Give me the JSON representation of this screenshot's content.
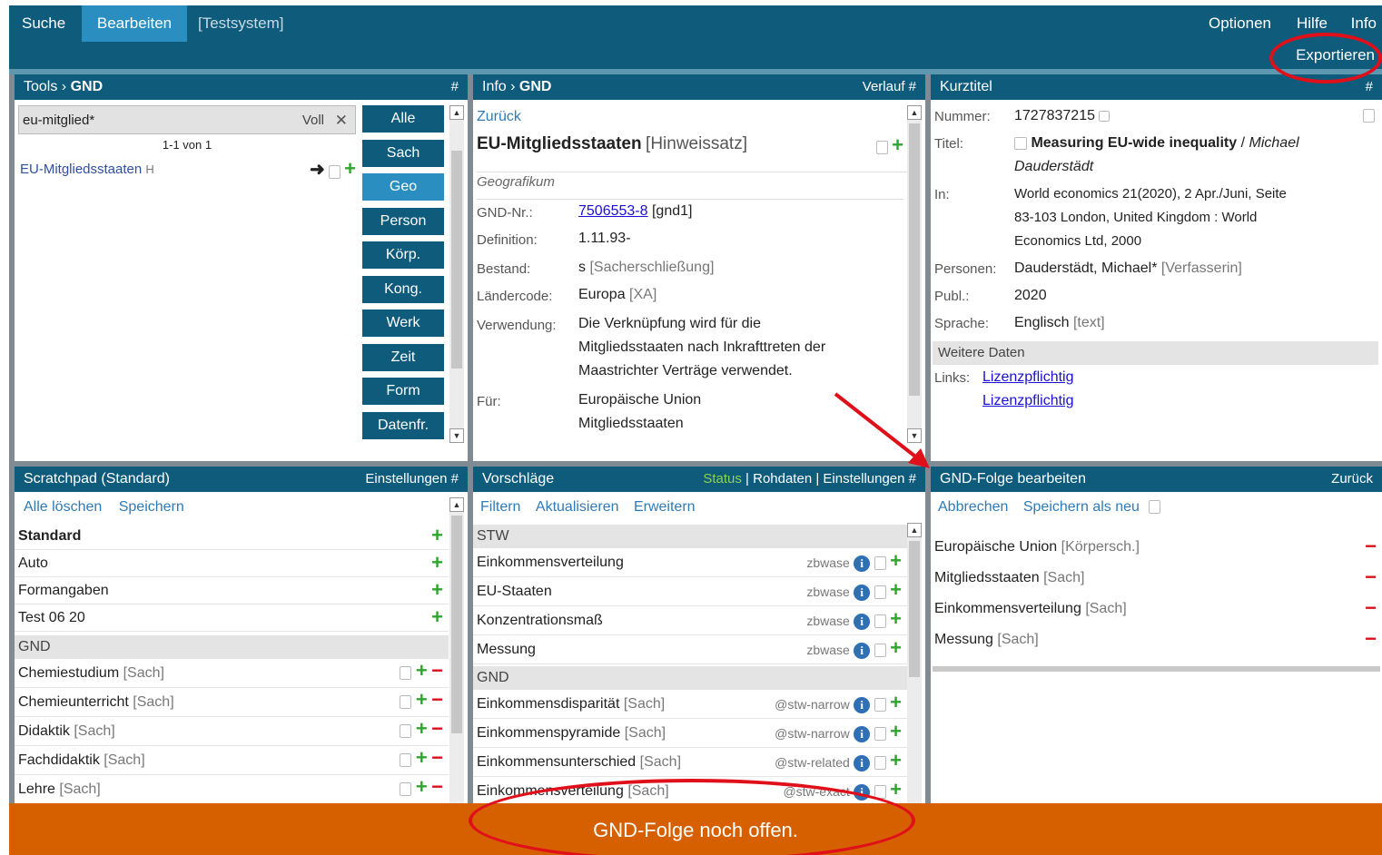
{
  "topnav": {
    "suche": "Suche",
    "bearbeiten": "Bearbeiten",
    "testsystem": "[Testsystem]",
    "optionen": "Optionen",
    "hilfe": "Hilfe",
    "info": "Info",
    "exportieren": "Exportieren"
  },
  "tools": {
    "title_prefix": "Tools ›",
    "title_main": "GND",
    "hash": "#",
    "search_value": "eu-mitglied*",
    "search_mode": "Voll",
    "count": "1-1 von 1",
    "result_label": "EU-Mitgliedsstaaten",
    "result_tag": "H",
    "categories": [
      "Alle",
      "Sach",
      "Geo",
      "Person",
      "Körp.",
      "Kong.",
      "Werk",
      "Zeit",
      "Form",
      "Datenfr."
    ]
  },
  "info": {
    "title_prefix": "Info ›",
    "title_main": "GND",
    "verlauf": "Verlauf #",
    "back": "Zurück",
    "heading": "EU-Mitgliedsstaaten",
    "heading_tag": "[Hinweissatz]",
    "type": "Geografikum",
    "gnd_label": "GND-Nr.:",
    "gnd_value": "7506553-8",
    "gnd_suffix": "[gnd1]",
    "def_label": "Definition:",
    "def_value": "1.11.93-",
    "bestand_label": "Bestand:",
    "bestand_value": "s",
    "bestand_suffix": "[Sacherschließung]",
    "laender_label": "Ländercode:",
    "laender_value": "Europa",
    "laender_suffix": "[XA]",
    "verw_label": "Verwendung:",
    "verw_lines": [
      "Die Verknüpfung wird für die",
      "Mitgliedsstaaten nach Inkrafttreten der",
      "Maastrichter Verträge verwendet."
    ],
    "fuer_label": "Für:",
    "fuer_lines": [
      "Europäische Union",
      "Mitgliedsstaaten"
    ]
  },
  "kurztitel": {
    "title": "Kurztitel",
    "hash": "#",
    "nummer_label": "Nummer:",
    "nummer_value": "1727837215",
    "titel_label": "Titel:",
    "titel_main": "Measuring EU-wide inequality",
    "titel_sep": "/",
    "titel_author": "Michael",
    "titel_author2": "Dauderstädt",
    "in_label": "In:",
    "in_lines": [
      "World economics 21(2020), 2 Apr./Juni, Seite",
      "83-103 London, United Kingdom : World",
      "Economics Ltd, 2000"
    ],
    "personen_label": "Personen:",
    "personen_value": "Dauderstädt, Michael*",
    "personen_role": "[Verfasserin]",
    "publ_label": "Publ.:",
    "publ_value": "2020",
    "sprache_label": "Sprache:",
    "sprache_value": "Englisch",
    "sprache_code": "[text]",
    "weitere": "Weitere Daten",
    "links_label": "Links:",
    "links": [
      "Lizenzpflichtig",
      "Lizenzpflichtig"
    ]
  },
  "scratchpad": {
    "title": "Scratchpad (Standard)",
    "settings": "Einstellungen #",
    "alle_loeschen": "Alle löschen",
    "speichern": "Speichern",
    "lists": [
      "Standard",
      "Auto",
      "Formangaben",
      "Test 06 20"
    ],
    "section": "GND",
    "items": [
      {
        "label": "Chemiestudium",
        "tag": "[Sach]"
      },
      {
        "label": "Chemieunterricht",
        "tag": "[Sach]"
      },
      {
        "label": "Didaktik",
        "tag": "[Sach]"
      },
      {
        "label": "Fachdidaktik",
        "tag": "[Sach]"
      },
      {
        "label": "Lehre",
        "tag": "[Sach]"
      }
    ]
  },
  "vorschlaege": {
    "title": "Vorschläge",
    "status": "Status",
    "sep": "|",
    "rohdaten": "Rohdaten",
    "einstellungen": "Einstellungen #",
    "filtern": "Filtern",
    "aktualisieren": "Aktualisieren",
    "erweitern": "Erweitern",
    "section1": "STW",
    "stw": [
      {
        "label": "Einkommensverteilung",
        "src": "zbwase"
      },
      {
        "label": "EU-Staaten",
        "src": "zbwase"
      },
      {
        "label": "Konzentrationsmaß",
        "src": "zbwase"
      },
      {
        "label": "Messung",
        "src": "zbwase"
      }
    ],
    "section2": "GND",
    "gnd": [
      {
        "label": "Einkommensdisparität",
        "tag": "[Sach]",
        "src": "@stw-narrow"
      },
      {
        "label": "Einkommenspyramide",
        "tag": "[Sach]",
        "src": "@stw-narrow"
      },
      {
        "label": "Einkommensunterschied",
        "tag": "[Sach]",
        "src": "@stw-related"
      },
      {
        "label": "Einkommensverteilung",
        "tag": "[Sach]",
        "src": "@stw-exact"
      }
    ]
  },
  "folge": {
    "title": "GND-Folge bearbeiten",
    "zurueck": "Zurück",
    "abbrechen": "Abbrechen",
    "speichern_neu": "Speichern als neu",
    "items": [
      {
        "label": "Europäische Union",
        "tag": "[Körpersch.]"
      },
      {
        "label": "Mitgliedsstaaten",
        "tag": "[Sach]"
      },
      {
        "label": "Einkommensverteilung",
        "tag": "[Sach]"
      },
      {
        "label": "Messung",
        "tag": "[Sach]"
      }
    ]
  },
  "footer": "GND-Folge noch offen.",
  "colors": {
    "header": "#0f5b7c",
    "active": "#2a8fc0",
    "footer": "#d66000",
    "annotation": "#e0101a"
  }
}
